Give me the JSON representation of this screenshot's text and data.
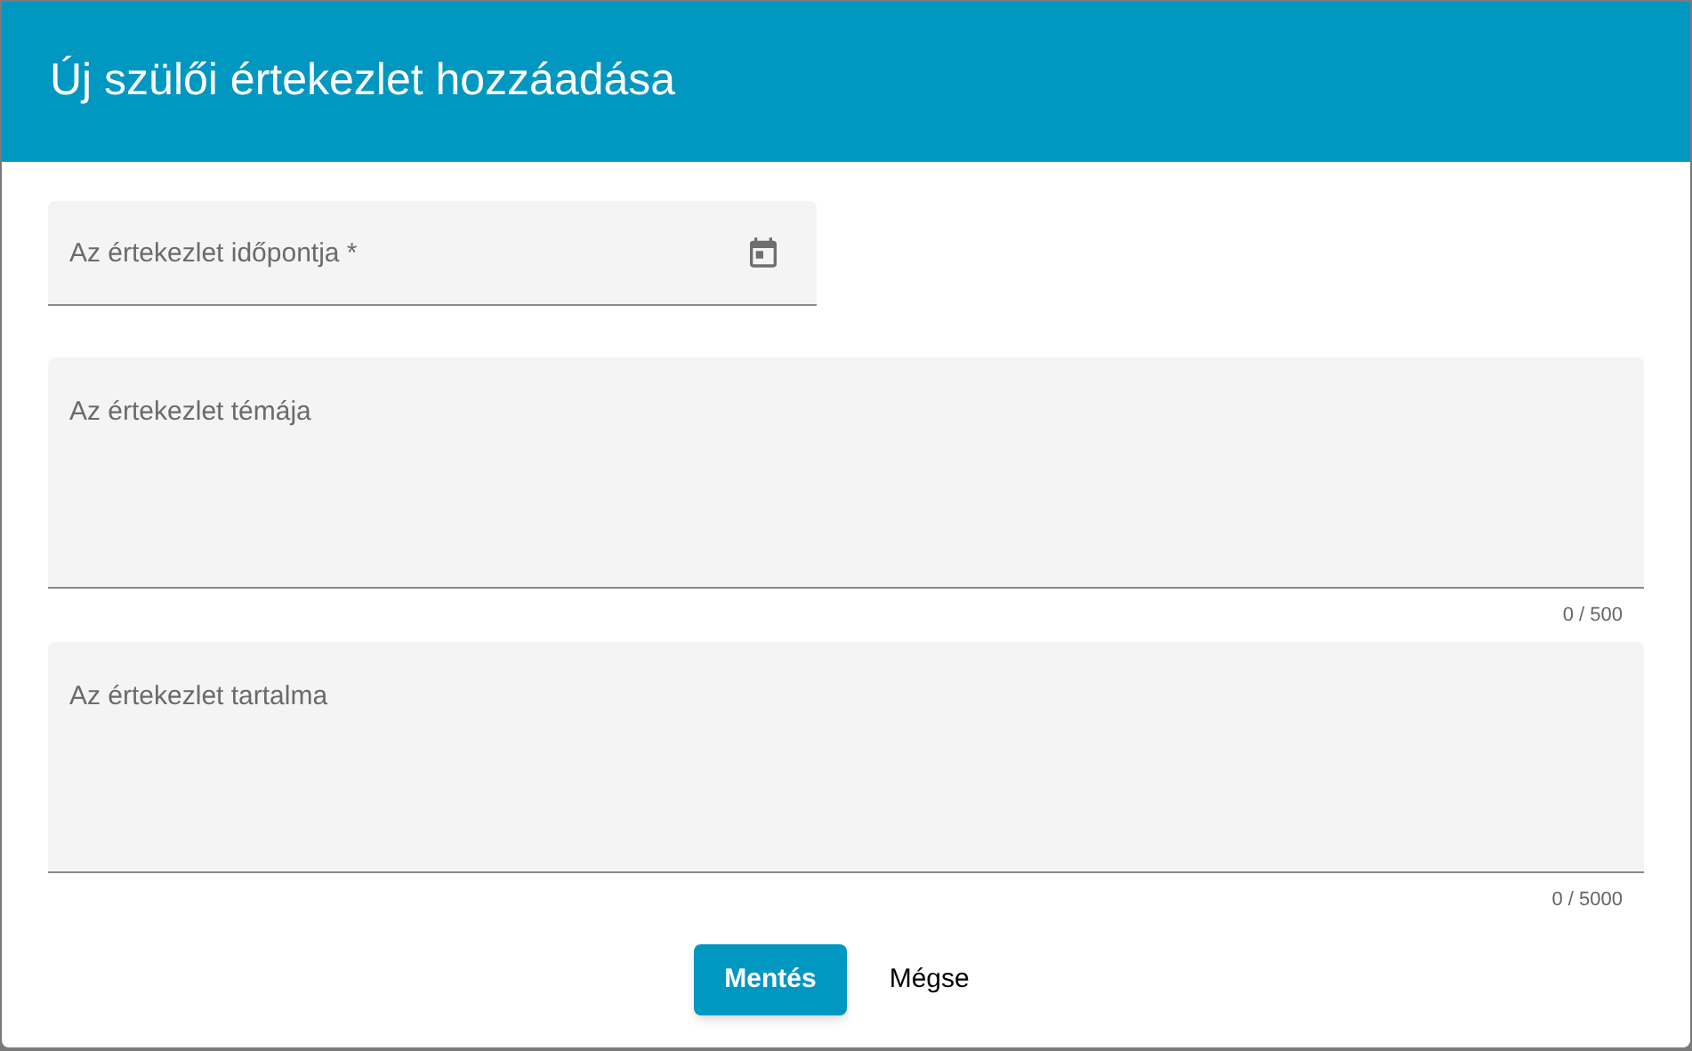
{
  "dialog": {
    "title": "Új szülői értekezlet hozzáadása"
  },
  "fields": [
    {
      "kind": "date",
      "placeholder": "Az értekezlet időpontja *"
    },
    {
      "kind": "textarea",
      "placeholder": "Az értekezlet témája",
      "counter": "0 / 500"
    },
    {
      "kind": "textarea",
      "placeholder": "Az értekezlet tartalma",
      "counter": "0 / 5000"
    }
  ],
  "buttons": [
    {
      "label": "Mentés",
      "kind": "primary"
    },
    {
      "label": "Mégse",
      "kind": "text"
    }
  ]
}
